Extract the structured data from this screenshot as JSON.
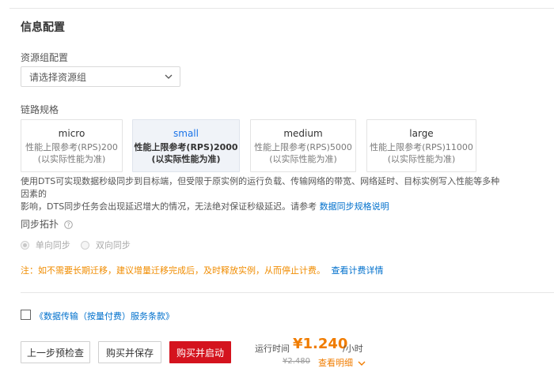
{
  "section": {
    "title": "信息配置"
  },
  "resource_group": {
    "label": "资源组配置",
    "placeholder": "请选择资源组"
  },
  "link_spec": {
    "label": "链路规格",
    "cards": [
      {
        "name": "micro",
        "line1": "性能上限参考(RPS)200",
        "line2": "(以实际性能为准)"
      },
      {
        "name": "small",
        "line1": "性能上限参考(RPS)2000",
        "line2": "(以实际性能为准)"
      },
      {
        "name": "medium",
        "line1": "性能上限参考(RPS)5000",
        "line2": "(以实际性能为准)"
      },
      {
        "name": "large",
        "line1": "性能上限参考(RPS)11000",
        "line2": "(以实际性能为准)"
      }
    ],
    "selected": "small",
    "description_line1": "使用DTS可实现数据秒级同步到目标端，但受限于原实例的运行负载、传输网络的带宽、网络延时、目标实例写入性能等多种因素的",
    "description_line2": "影响，DTS同步任务会出现延迟增大的情况，无法绝对保证秒级延迟。请参考",
    "description_link": "数据同步规格说明"
  },
  "topology": {
    "label": "同步拓扑",
    "options": [
      "单向同步",
      "双向同步"
    ],
    "selected": "单向同步"
  },
  "note": {
    "text": "注：如不需要长期迁移，建议增量迁移完成后，及时释放实例，从而停止计费。",
    "link": "查看计费详情"
  },
  "terms": {
    "text": "《数据传输（按量付费）服务条款》",
    "checked": false
  },
  "footer": {
    "prev_button": "上一步预检查",
    "buy_save_button": "购买并保存",
    "buy_start_button": "购买并启动",
    "runtime_label": "运行时间",
    "price": "¥1.240",
    "price_unit": "/小时",
    "original_price": "¥2.480",
    "details_link": "查看明细"
  },
  "colors": {
    "accent": "#d4131e",
    "link": "#0070cc",
    "warning": "#f08c00",
    "price": "#f07c00"
  }
}
